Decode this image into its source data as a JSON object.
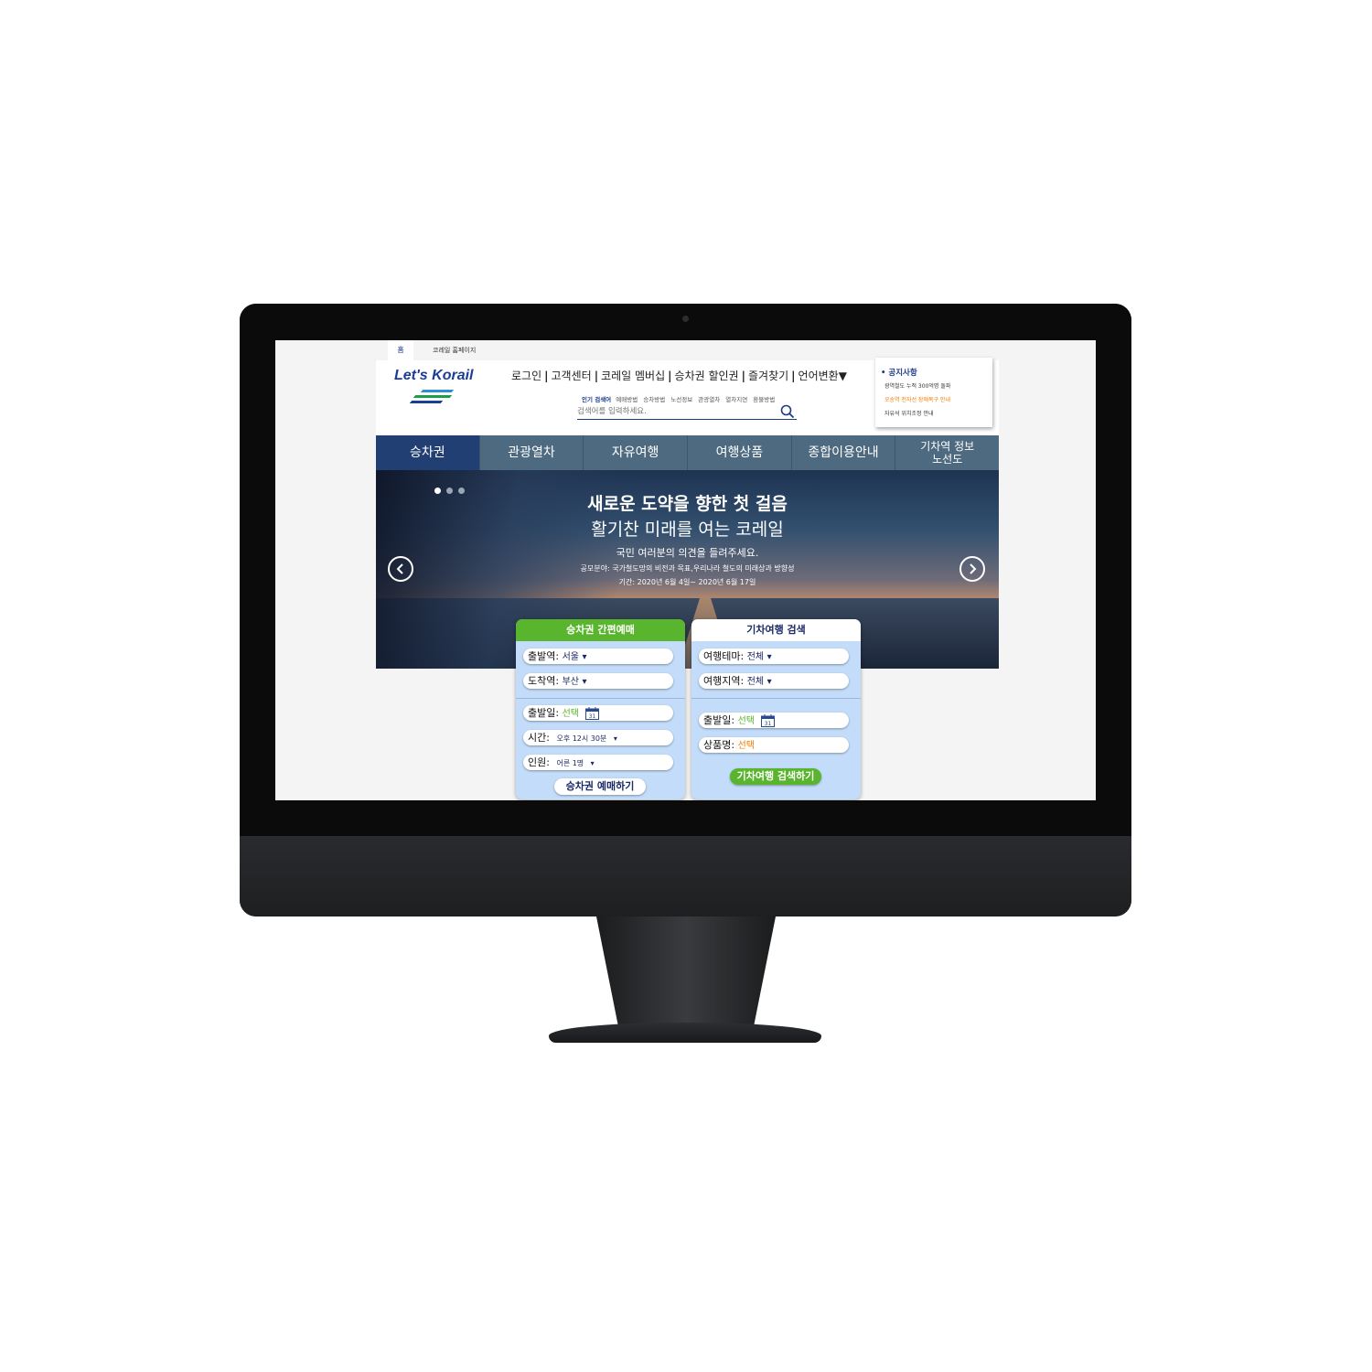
{
  "topbar": {
    "home_tab": "홈",
    "korail_tab": "코레일 홈페이지"
  },
  "logo": {
    "text": "Let's Korail",
    "colors": [
      "#2b8fd6",
      "#1d9f4a",
      "#1a3e96"
    ]
  },
  "util_menu": [
    "로그인",
    "고객센터",
    "코레일 멤버십",
    "승차권 할인권",
    "즐겨찾기",
    "언어변환▼"
  ],
  "popular": {
    "label": "인기 검색어",
    "keywords": [
      "예매방법",
      "승차방법",
      "노선정보",
      "관광열차",
      "열차지연",
      "환불방법"
    ]
  },
  "search": {
    "placeholder": "검색어를 입력하세요.",
    "icon": "search-icon"
  },
  "notice": {
    "title": "공지사항",
    "items": [
      {
        "text": "광역철도 누적 300억명 돌파",
        "color": "#333333"
      },
      {
        "text": "오송역 천자선 장애복구 안내",
        "color": "#ef7d00"
      },
      {
        "text": "자유석 위치조정 안내",
        "color": "#333333"
      }
    ]
  },
  "nav": {
    "items": [
      "승차권",
      "관광열차",
      "자유여행",
      "여행상품",
      "종합이용안내"
    ],
    "last_line1": "기차역 정보",
    "last_line2": "노선도",
    "active_index": 0
  },
  "hero": {
    "headline": "새로운 도약을 향한 첫 걸음",
    "subheadline": "활기찬 미래를 여는 코레일",
    "line1": "국민 여러분의 의견을 들려주세요.",
    "line2": "공모분야: 국가철도망의 비전과 목표,우리나라 철도의 미래상과 방향성",
    "line3": "기간: 2020년 6월 4일~ 2020년 6월 17일",
    "slide_count": 3,
    "current_slide": 1
  },
  "ticket_panel": {
    "title": "승차권 간편예매",
    "header_color": "#5ab52e",
    "departure_label": "출발역:",
    "departure_value": "서울",
    "arrival_label": "도착역:",
    "arrival_value": "부산",
    "date_label": "출발일:",
    "date_value": "선택",
    "date_day": "31",
    "time_label": "시간:",
    "time_value": "오후 12시 30분",
    "people_label": "인원:",
    "people_value": "어른 1명",
    "button": "승차권 예매하기"
  },
  "travel_panel": {
    "title": "기차여행 검색",
    "header_color": "#ffffff",
    "theme_label": "여행테마:",
    "theme_value": "전체",
    "region_label": "여행지역:",
    "region_value": "전체",
    "date_label": "출발일:",
    "date_value": "선택",
    "date_day": "31",
    "product_label": "상품명:",
    "product_value": "선택",
    "button": "기차여행 검색하기"
  }
}
